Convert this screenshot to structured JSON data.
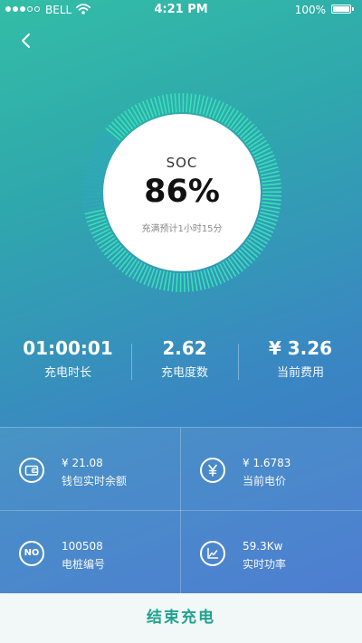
{
  "status_bar": {
    "carrier": "BELL",
    "time": "4:21 PM",
    "battery": "100%",
    "battery_level": 1.0,
    "signal_bars": 5,
    "signal_filled": 3,
    "icons": [
      "wifi-icon",
      "battery-icon"
    ]
  },
  "header": {
    "back_icon": "chevron-left-icon"
  },
  "gauge": {
    "label": "SOC",
    "value": "86%",
    "level": 0.86,
    "eta": "充满预计1小时15分",
    "colors": {
      "track": "#2fa8c4",
      "fill": "#36e2b8",
      "center": "#ffffff"
    }
  },
  "stats": [
    {
      "value": "01:00:01",
      "label": "充电时长"
    },
    {
      "value": "2.62",
      "label": "充电度数"
    },
    {
      "value": "¥ 3.26",
      "label": "当前费用"
    }
  ],
  "info": [
    {
      "icon": "wallet-icon",
      "value": "¥ 21.08",
      "label": "钱包实时余额"
    },
    {
      "icon": "yuan-icon",
      "value": "¥ 1.6783",
      "label": "当前电价"
    },
    {
      "icon": "no-icon",
      "icon_text": "NO",
      "value": "100508",
      "label": "电桩编号"
    },
    {
      "icon": "line-chart-icon",
      "value": "59.3Kw",
      "label": "实时功率"
    }
  ],
  "footer": {
    "button": "结束充电"
  },
  "colors": {
    "accent": "#1fa38e",
    "gradient_top": "#33bda6",
    "gradient_bottom": "#3f70cf",
    "button_bg": "#f2f7f8"
  }
}
